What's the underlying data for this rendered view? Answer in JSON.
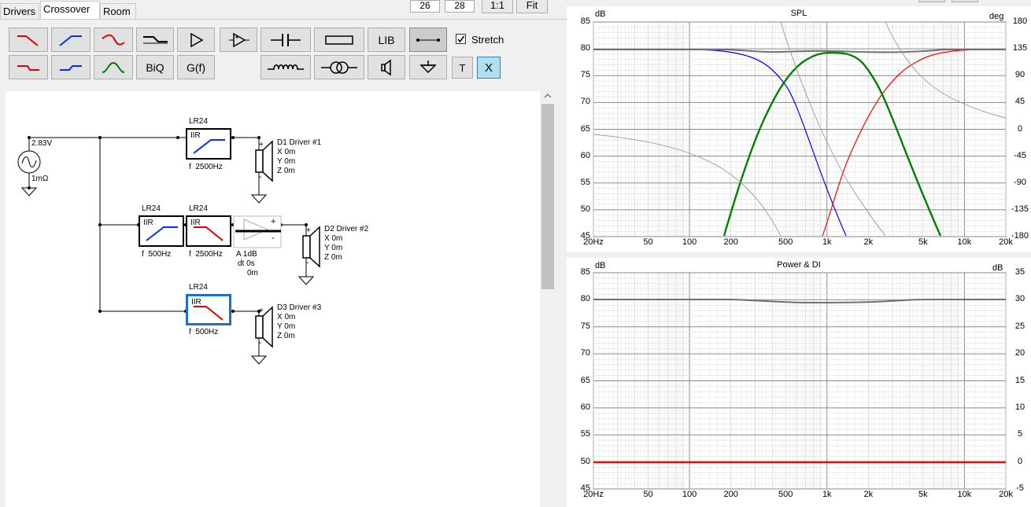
{
  "tabs": [
    "Drivers",
    "Crossover",
    "Room"
  ],
  "top_fields": [
    "26",
    "28"
  ],
  "top_buttons": [
    "1:1",
    "Fit"
  ],
  "toolbar": {
    "lib_label": "LIB",
    "biq_label": "BiQ",
    "gf_label": "G(f)",
    "t_label": "T",
    "x_label": "X",
    "stretch_label": "Stretch",
    "stretch_checked": true
  },
  "schematic": {
    "source": {
      "voltage": "2.83V",
      "impedance": "1mΩ"
    },
    "filters": [
      {
        "type": "LR24",
        "kind": "IIR",
        "freq_label": "f",
        "freq": "2500Hz",
        "shape": "highpass"
      },
      {
        "type": "LR24",
        "kind": "IIR",
        "freq_label": "f",
        "freq": "500Hz",
        "shape": "highpass"
      },
      {
        "type": "LR24",
        "kind": "IIR",
        "freq_label": "f",
        "freq": "2500Hz",
        "shape": "lowpass"
      },
      {
        "type": "LR24",
        "kind": "IIR",
        "freq_label": "f",
        "freq": "500Hz",
        "shape": "lowpass"
      }
    ],
    "amplifier": {
      "gain": "A  1dB",
      "delay": "dt 0s",
      "distance": "0m",
      "plus": "+",
      "minus": "-"
    },
    "drivers": [
      {
        "name": "D1 Driver #1",
        "x": "X 0m",
        "y": "Y 0m",
        "z": "Z 0m",
        "plus": "+",
        "minus": "-"
      },
      {
        "name": "D2 Driver #2",
        "x": "X 0m",
        "y": "Y 0m",
        "z": "Z 0m",
        "plus": "+",
        "minus": "-"
      },
      {
        "name": "D3 Driver #3",
        "x": "X 0m",
        "y": "Y 0m",
        "z": "Z 0m",
        "plus": "+",
        "minus": "-"
      }
    ]
  },
  "spl_graph": {
    "title": "SPL",
    "y_unit_left": "dB",
    "y_unit_right": "deg",
    "y_ticks_left": [
      "85",
      "80",
      "75",
      "70",
      "65",
      "60",
      "55",
      "50",
      "45"
    ],
    "y_ticks_right": [
      "180",
      "135",
      "90",
      "45",
      "0",
      "-45",
      "-90",
      "-135",
      "-180"
    ],
    "x_ticks": [
      "20Hz",
      "50",
      "100",
      "200",
      "500",
      "1k",
      "2k",
      "5k",
      "10k",
      "20k"
    ]
  },
  "power_graph": {
    "title": "Power & DI",
    "y_unit_left": "dB",
    "y_unit_right": "dB",
    "y_ticks_left": [
      "85",
      "80",
      "75",
      "70",
      "65",
      "60",
      "55",
      "50",
      "45"
    ],
    "y_ticks_right": [
      "35",
      "30",
      "25",
      "20",
      "15",
      "10",
      "5",
      "0",
      "-5"
    ],
    "x_ticks": [
      "20Hz",
      "50",
      "100",
      "200",
      "500",
      "1k",
      "2k",
      "5k",
      "10k",
      "20k"
    ]
  },
  "colors": {
    "tweeter": "#0000ff",
    "midrange": "#008000",
    "woofer": "#ff0000",
    "phase": "#999999",
    "sum": "#606060",
    "selected": "#1f6fc8"
  }
}
